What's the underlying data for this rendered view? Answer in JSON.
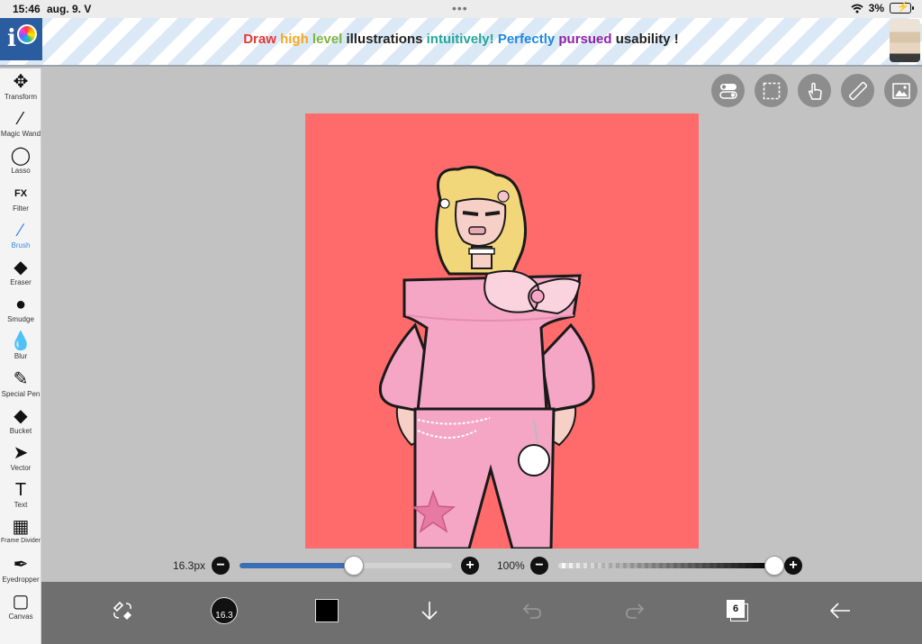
{
  "status": {
    "time": "15:46",
    "date": "aug. 9. V",
    "dots": "•••",
    "battery": "3%"
  },
  "banner": {
    "ad_words": [
      {
        "text": "Draw",
        "color": "#e53935"
      },
      {
        "text": "high",
        "color": "#f5a623"
      },
      {
        "text": "level",
        "color": "#7cb342"
      },
      {
        "text": "illustrations",
        "color": "#222222"
      },
      {
        "text": "intuitively!",
        "color": "#26a69a"
      },
      {
        "text": "Perfectly",
        "color": "#1e88e5"
      },
      {
        "text": "pursued",
        "color": "#8e24aa"
      },
      {
        "text": "usability",
        "color": "#222222"
      },
      {
        "text": "!",
        "color": "#222222"
      }
    ],
    "logo_letter": "i"
  },
  "tools": [
    {
      "label": "Transform",
      "icon": "move-arrows-icon",
      "glyph": "✥"
    },
    {
      "label": "Magic Wand",
      "icon": "magic-wand-icon",
      "glyph": "⁄"
    },
    {
      "label": "Lasso",
      "icon": "lasso-icon",
      "glyph": "◯"
    },
    {
      "label": "Filter",
      "icon": "fx-filter-icon",
      "glyph": "FX"
    },
    {
      "label": "Brush",
      "icon": "brush-icon",
      "glyph": "∕",
      "active": true
    },
    {
      "label": "Eraser",
      "icon": "eraser-icon",
      "glyph": "◆"
    },
    {
      "label": "Smudge",
      "icon": "smudge-icon",
      "glyph": "●"
    },
    {
      "label": "Blur",
      "icon": "droplet-icon",
      "glyph": "💧"
    },
    {
      "label": "Special Pen",
      "icon": "special-pen-icon",
      "glyph": "✎"
    },
    {
      "label": "Bucket",
      "icon": "bucket-icon",
      "glyph": "◆"
    },
    {
      "label": "Vector",
      "icon": "cursor-arrow-icon",
      "glyph": "➤"
    },
    {
      "label": "Text",
      "icon": "text-t-icon",
      "glyph": "T"
    },
    {
      "label": "Frame Divider",
      "icon": "frame-divider-icon",
      "glyph": "▦"
    },
    {
      "label": "Eyedropper",
      "icon": "eyedropper-icon",
      "glyph": "✒"
    },
    {
      "label": "Canvas",
      "icon": "canvas-square-icon",
      "glyph": "▢"
    }
  ],
  "brush": {
    "size_label": "16.3px",
    "size_fraction": 0.54,
    "opacity_label": "100%",
    "opacity_fraction": 1.0,
    "minus": "−",
    "plus": "+"
  },
  "bottom": {
    "brush_size_badge": "16.3",
    "layer_count": "6",
    "color": "#000000"
  },
  "colors": {
    "canvas_bg": "#ff6b6b",
    "accent": "#3a86e8",
    "slider_fill": "#3a6fb5"
  }
}
